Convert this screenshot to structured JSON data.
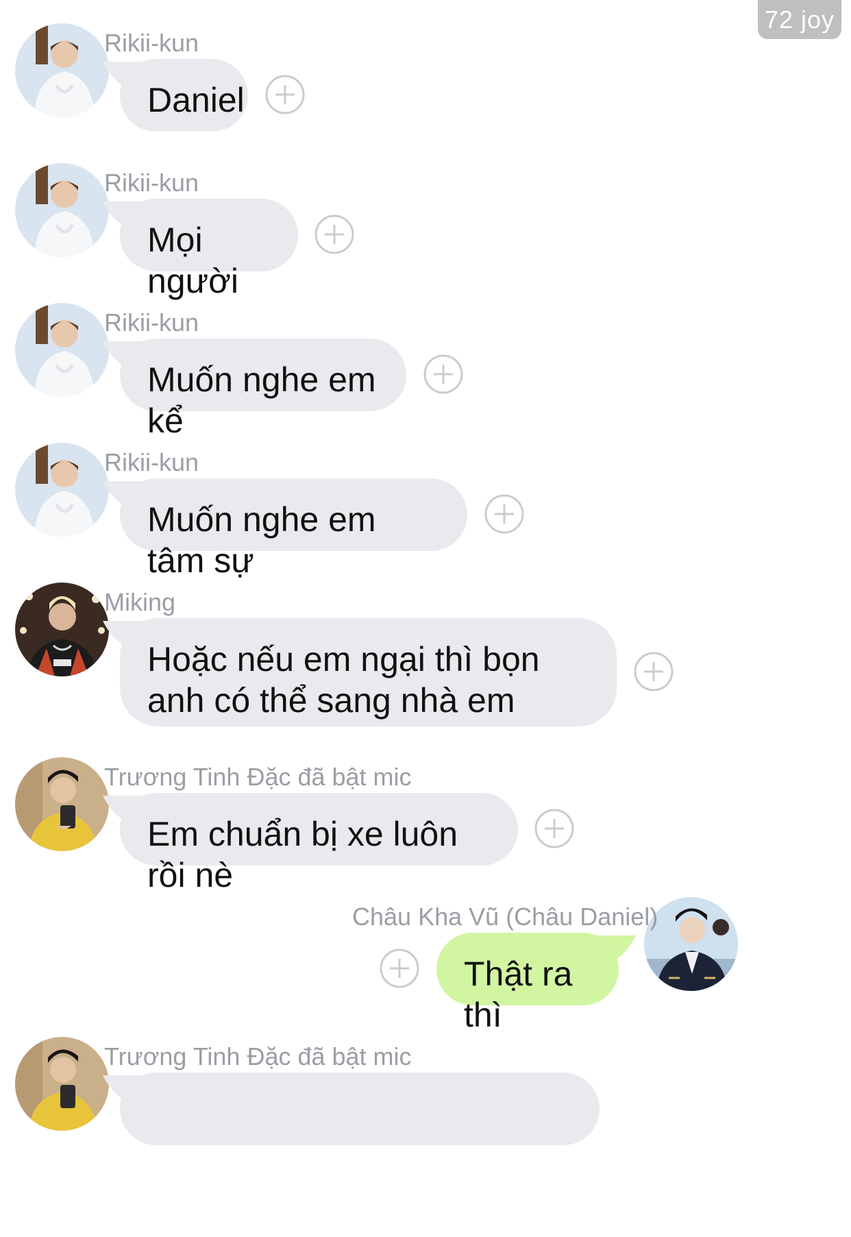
{
  "watermark": "72 joy",
  "colors": {
    "incoming_bubble": "#e8eaed",
    "outgoing_bubble": "#d2f5a2",
    "sender_name": "#9a9ea4",
    "plus_icon": "#c8cbd0"
  },
  "messages": [
    {
      "sender": "Rikii-kun",
      "text": "Daniel",
      "side": "left",
      "avatar": "rikii-avatar"
    },
    {
      "sender": "Rikii-kun",
      "text": "Mọi người",
      "side": "left",
      "avatar": "rikii-avatar"
    },
    {
      "sender": "Rikii-kun",
      "text": "Muốn nghe em kể",
      "side": "left",
      "avatar": "rikii-avatar"
    },
    {
      "sender": "Rikii-kun",
      "text": "Muốn nghe em tâm sự",
      "side": "left",
      "avatar": "rikii-avatar"
    },
    {
      "sender": "Miking",
      "text": "Hoặc nếu em ngại thì bọn anh có thể sang nhà em",
      "side": "left",
      "avatar": "miking-avatar"
    },
    {
      "sender": "Trương Tinh Đặc đã bật mic",
      "text": "Em chuẩn bị xe luôn rồi nè",
      "side": "left",
      "avatar": "truong-tinh-dac-avatar"
    },
    {
      "sender": "Châu Kha Vũ (Châu Daniel)",
      "text": "Thật ra thì",
      "side": "right",
      "avatar": "chau-kha-vu-avatar"
    },
    {
      "sender": "Trương Tinh Đặc đã bật mic",
      "text": "",
      "side": "left",
      "avatar": "truong-tinh-dac-avatar"
    }
  ],
  "icons": {
    "add": "plus-circle-icon"
  }
}
